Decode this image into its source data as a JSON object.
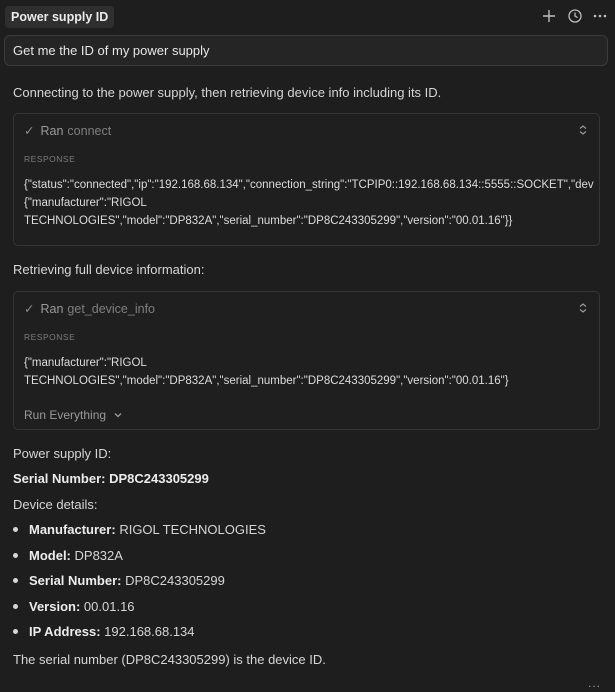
{
  "header": {
    "tab_title": "Power supply ID",
    "icons": [
      "plus-icon",
      "history-icon",
      "more-icon"
    ]
  },
  "prompt": "Get me the ID of my power supply",
  "msg1": "Connecting to the power supply, then retrieving device info including its ID.",
  "tool1": {
    "ran": "Ran",
    "name": "connect",
    "response_label": "RESPONSE",
    "line1": "{\"status\":\"connected\",\"ip\":\"192.168.68.134\",\"connection_string\":\"TCPIP0::192.168.68.134::5555::SOCKET\",\"dev",
    "line2": "{\"manufacturer\":\"RIGOL",
    "line3": "TECHNOLOGIES\",\"model\":\"DP832A\",\"serial_number\":\"DP8C243305299\",\"version\":\"00.01.16\"}}"
  },
  "msg2": "Retrieving full device information:",
  "tool2": {
    "ran": "Ran",
    "name": "get_device_info",
    "response_label": "RESPONSE",
    "line1": "{\"manufacturer\":\"RIGOL",
    "line2": "TECHNOLOGIES\",\"model\":\"DP832A\",\"serial_number\":\"DP8C243305299\",\"version\":\"00.01.16\"}",
    "run_everything": "Run Everything"
  },
  "answer": {
    "heading": "Power supply ID:",
    "serial_label": "Serial Number:",
    "serial_value": "DP8C243305299",
    "details_heading": "Device details:",
    "details": [
      {
        "label": "Manufacturer:",
        "value": "RIGOL TECHNOLOGIES"
      },
      {
        "label": "Model:",
        "value": "DP832A"
      },
      {
        "label": "Serial Number:",
        "value": "DP8C243305299"
      },
      {
        "label": "Version:",
        "value": "00.01.16"
      },
      {
        "label": "IP Address:",
        "value": "192.168.68.134"
      }
    ],
    "conclusion": "The serial number (DP8C243305299) is the device ID."
  },
  "footer": {
    "ellipsis": "..."
  }
}
